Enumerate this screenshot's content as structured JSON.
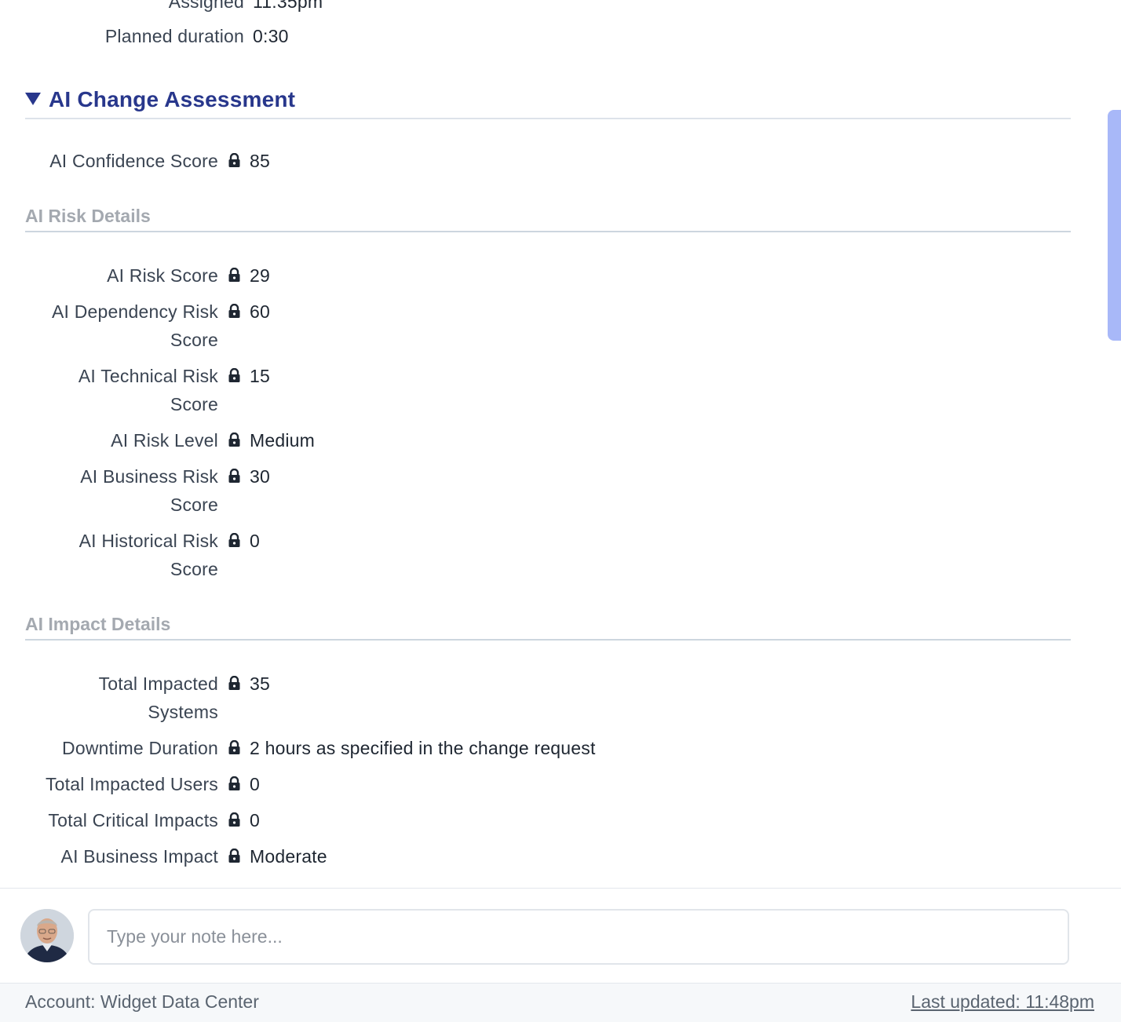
{
  "top_fields": [
    {
      "label": "Assigned",
      "value": "11:35pm"
    },
    {
      "label": "Planned duration",
      "value": "0:30"
    }
  ],
  "section": {
    "title": "AI Change Assessment",
    "confidence": {
      "label": "AI Confidence Score",
      "value": "85"
    }
  },
  "risk": {
    "heading": "AI Risk Details",
    "fields": [
      {
        "label_line1": "AI Risk Score",
        "label_line2": "",
        "value": "29"
      },
      {
        "label_line1": "AI Dependency Risk",
        "label_line2": "Score",
        "value": "60"
      },
      {
        "label_line1": "AI Technical Risk",
        "label_line2": "Score",
        "value": "15"
      },
      {
        "label_line1": "AI Risk Level",
        "label_line2": "",
        "value": "Medium"
      },
      {
        "label_line1": "AI Business Risk",
        "label_line2": "Score",
        "value": "30"
      },
      {
        "label_line1": "AI Historical Risk",
        "label_line2": "Score",
        "value": "0"
      }
    ]
  },
  "impact": {
    "heading": "AI Impact Details",
    "fields": [
      {
        "label_line1": "Total Impacted",
        "label_line2": "Systems",
        "value": "35"
      },
      {
        "label_line1": "Downtime Duration",
        "label_line2": "",
        "value": "2 hours as specified in the change request"
      },
      {
        "label_line1": "Total Impacted Users",
        "label_line2": "",
        "value": "0"
      },
      {
        "label_line1": "Total Critical Impacts",
        "label_line2": "",
        "value": "0"
      },
      {
        "label_line1": "AI Business Impact",
        "label_line2": "",
        "value": "Moderate"
      }
    ]
  },
  "note": {
    "placeholder": "Type your note here..."
  },
  "footer": {
    "account": "Account: Widget Data Center",
    "last_updated": "Last updated: 11:48pm"
  },
  "icons": {
    "field_lock": "lock-icon",
    "collapse": "triangle-down-icon"
  },
  "colors": {
    "accent": "#28378c",
    "subheading": "#a4a9b0",
    "scrollbar": "#a8b8f8"
  }
}
